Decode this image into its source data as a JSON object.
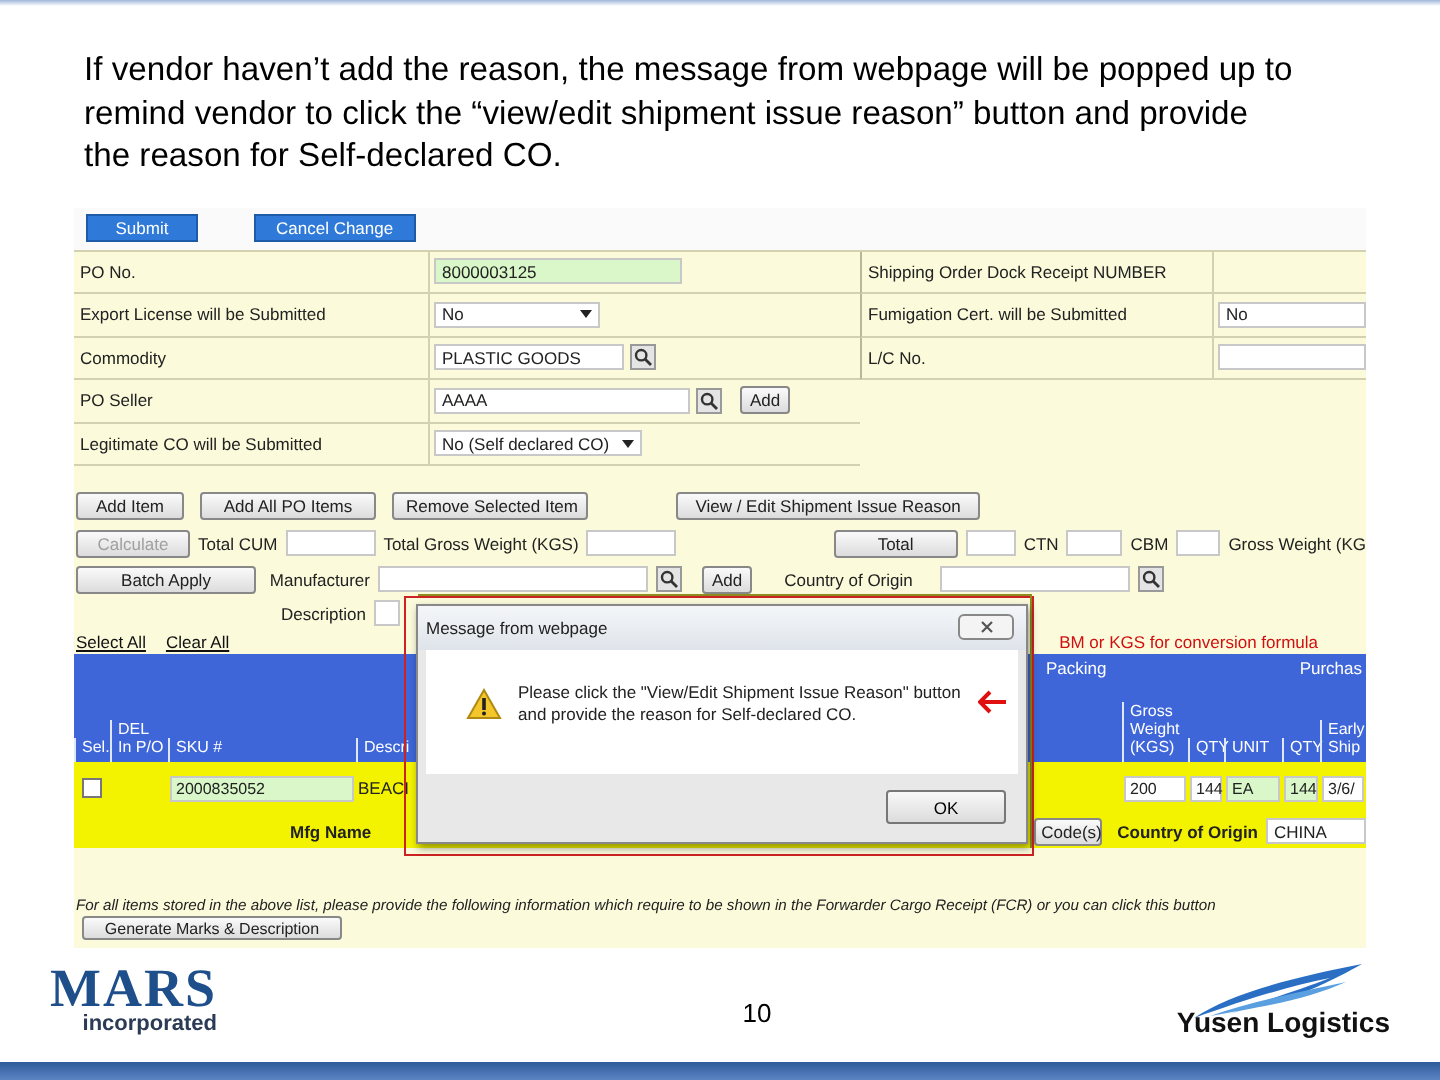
{
  "instruction": "If vendor haven’t add the reason, the message from webpage will be popped up to remind vendor to click the “view/edit shipment issue reason” button and provide the reason for Self-declared CO.",
  "screen": {
    "top_buttons": [
      "Submit",
      "Cancel Change"
    ],
    "left_form": [
      {
        "label": "PO No.",
        "kind": "text",
        "value": "8000003125",
        "highlighted": true
      },
      {
        "label": "Export License will be Submitted",
        "kind": "select",
        "value": "No",
        "highlighted": false
      },
      {
        "label": "Commodity",
        "kind": "lookup",
        "value": "PLASTIC GOODS",
        "highlighted": false
      },
      {
        "label": "PO Seller",
        "kind": "lookup_add",
        "value": "AAAA",
        "add_button": "Add",
        "highlighted": false
      },
      {
        "label": "Legitimate CO will be Submitted",
        "kind": "select",
        "value": "No (Self declared CO)",
        "highlighted": false
      }
    ],
    "right_form": [
      {
        "label": "Shipping Order Dock Receipt NUMBER",
        "kind": "none"
      },
      {
        "label": "Fumigation Cert. will be Submitted",
        "kind": "text",
        "value": "No"
      },
      {
        "label": "L/C No.",
        "kind": "text"
      }
    ],
    "action_buttons": [
      "Add Item",
      "Add All PO Items",
      "Remove Selected Item",
      "View / Edit Shipment Issue Reason"
    ],
    "totals": {
      "calculate": {
        "label": "Calculate",
        "disabled": true
      },
      "labels": [
        "Total CUM",
        "Total Gross Weight (KGS)"
      ],
      "total_button": "Total",
      "unit_labels": [
        "CTN",
        "CBM",
        "Gross Weight (KG"
      ]
    },
    "batch": {
      "apply_button": "Batch Apply",
      "manufacturer_label": "Manufacturer",
      "add_button": "Add",
      "country_label": "Country of Origin",
      "description_label": "Description"
    },
    "links": [
      "Select All",
      "Clear All"
    ],
    "conversion_note": "BM or KGS for conversion formula",
    "table": {
      "group_headers": [
        "Packing",
        "Purchas"
      ],
      "columns": [
        "Sel.",
        "DEL In P/O",
        "SKU #",
        "Descri",
        "Gross Weight (KGS)",
        "QTY",
        "UNIT",
        "QTY",
        "Early Ship"
      ],
      "row": {
        "checked": false,
        "sku": "2000835052",
        "description": "BEACI",
        "gross_weight": "200",
        "packing_qty": "144",
        "unit": "EA",
        "purchase_qty": "144",
        "early_ship": "3/6/",
        "mfg_label": "Mfg Name",
        "code_button": "Code(s)",
        "country_label": "Country of Origin",
        "country": "CHINA"
      }
    },
    "instructions_note": "For all items stored in the above list, please provide the following information which require to be shown in the Forwarder Cargo Receipt (FCR) or you can click this button",
    "generate_button": "Generate Marks & Description"
  },
  "dialog": {
    "title": "Message from webpage",
    "message": "Please click the \"View/Edit Shipment Issue Reason\" button and provide the reason for Self-declared CO.",
    "ok_button": "OK"
  },
  "footer": {
    "logo_left": "MARS",
    "logo_left_sub": "incorporated",
    "page_number": "10",
    "logo_right": "Yusen Logistics"
  }
}
